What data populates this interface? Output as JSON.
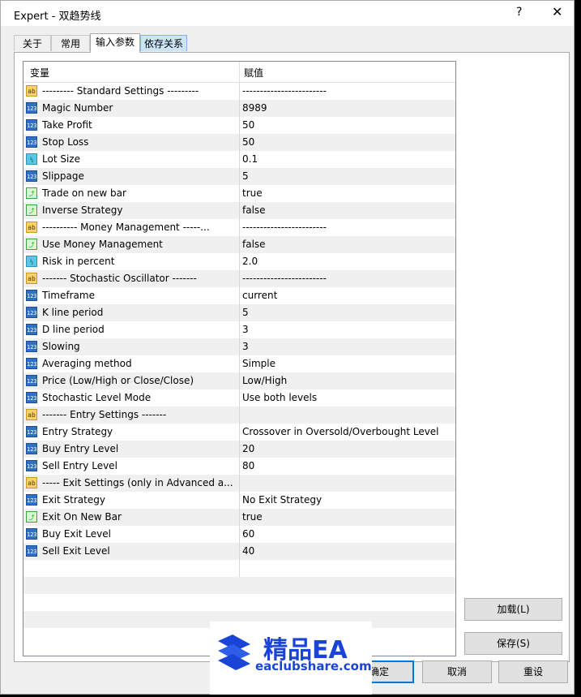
{
  "window": {
    "title": "Expert - 双趋势线",
    "help": "?",
    "close": "✕"
  },
  "tabs": [
    {
      "label": "关于"
    },
    {
      "label": "常用"
    },
    {
      "label": "输入参数"
    },
    {
      "label": "依存关系"
    }
  ],
  "grid": {
    "columns": [
      "变量",
      "赋值"
    ],
    "rows": [
      {
        "type": "str",
        "name": "---------    Standard Settings    ---------",
        "value": "------------------------"
      },
      {
        "type": "int",
        "name": "Magic Number",
        "value": "8989"
      },
      {
        "type": "int",
        "name": "Take Profit",
        "value": "50"
      },
      {
        "type": "int",
        "name": "Stop Loss",
        "value": "50"
      },
      {
        "type": "dbl",
        "name": "Lot Size",
        "value": "0.1"
      },
      {
        "type": "int",
        "name": "Slippage",
        "value": "5"
      },
      {
        "type": "bool",
        "name": "Trade on new bar",
        "value": "true"
      },
      {
        "type": "bool",
        "name": "Inverse Strategy",
        "value": "false"
      },
      {
        "type": "str",
        "name": "----------    Money Management    -----...",
        "value": "------------------------"
      },
      {
        "type": "bool",
        "name": "Use Money Management",
        "value": "false"
      },
      {
        "type": "dbl",
        "name": "Risk in percent",
        "value": "2.0"
      },
      {
        "type": "str",
        "name": "-------    Stochastic Oscillator    -------",
        "value": "------------------------"
      },
      {
        "type": "int",
        "name": "Timeframe",
        "value": "current"
      },
      {
        "type": "int",
        "name": "K line period",
        "value": "5"
      },
      {
        "type": "int",
        "name": "D line period",
        "value": "3"
      },
      {
        "type": "int",
        "name": "Slowing",
        "value": "3"
      },
      {
        "type": "int",
        "name": "Averaging method",
        "value": "Simple"
      },
      {
        "type": "int",
        "name": "Price (Low/High or Close/Close)",
        "value": "Low/High"
      },
      {
        "type": "int",
        "name": "Stochastic Level Mode",
        "value": "Use both levels"
      },
      {
        "type": "str",
        "name": "-------    Entry Settings    -------",
        "value": ""
      },
      {
        "type": "int",
        "name": "Entry Strategy",
        "value": "Crossover in Oversold/Overbought Level"
      },
      {
        "type": "int",
        "name": "Buy Entry Level",
        "value": "20"
      },
      {
        "type": "int",
        "name": "Sell Entry Level",
        "value": "80"
      },
      {
        "type": "str",
        "name": "-----    Exit Settings (only in Advanced a...",
        "value": ""
      },
      {
        "type": "int",
        "name": "Exit Strategy",
        "value": "No Exit Strategy"
      },
      {
        "type": "bool",
        "name": "Exit On New Bar",
        "value": "true"
      },
      {
        "type": "int",
        "name": "Buy Exit Level",
        "value": "60"
      },
      {
        "type": "int",
        "name": "Sell Exit Level",
        "value": "40"
      }
    ]
  },
  "icons": {
    "int": "123",
    "dbl": "½",
    "bool": "⤴",
    "str": "ab"
  },
  "buttons": {
    "load": "加载(L)",
    "save": "保存(S)",
    "ok": "确定",
    "cancel": "取消",
    "reset": "重设"
  },
  "watermark": {
    "title": "精品EA",
    "url": "eaclubshare.com"
  },
  "colors": {
    "accent": "#0078d7",
    "brand": "#1a44d6"
  }
}
